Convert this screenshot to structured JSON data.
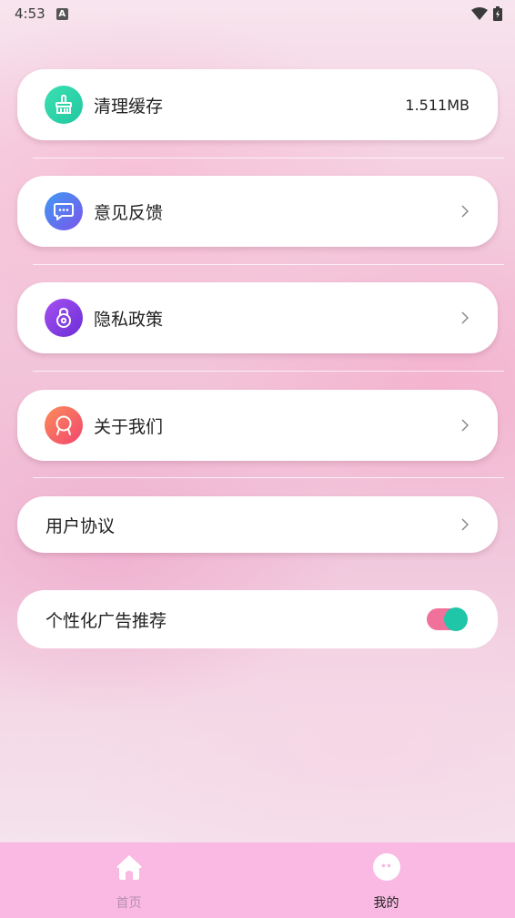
{
  "status_bar": {
    "time": "4:53",
    "badge": "A"
  },
  "settings": {
    "clear_cache": {
      "label": "清理缓存",
      "value": "1.511MB",
      "icon": "broom-icon",
      "color": "#2bd5a8"
    },
    "feedback": {
      "label": "意见反馈",
      "icon": "chat-bubble-icon",
      "color": "#5b7cf0"
    },
    "privacy": {
      "label": "隐私政策",
      "icon": "lock-icon",
      "color": "#8a3fe0"
    },
    "about": {
      "label": "关于我们",
      "icon": "badge-ribbon-icon",
      "color": "#f76a6a"
    },
    "user_agreement": {
      "label": "用户协议"
    },
    "personalized_ads": {
      "label": "个性化广告推荐",
      "enabled": true
    }
  },
  "bottom_nav": {
    "home": {
      "label": "首页",
      "icon": "home-icon",
      "active": false
    },
    "mine": {
      "label": "我的",
      "icon": "profile-face-icon",
      "active": true
    }
  },
  "colors": {
    "nav_bg": "#f9b9e3",
    "toggle_track": "#f0729a",
    "toggle_knob": "#1fc6a7"
  }
}
